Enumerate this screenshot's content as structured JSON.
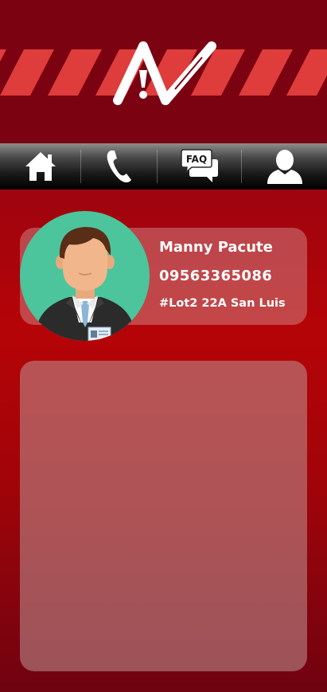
{
  "colors": {
    "header_background": "#7a0211",
    "stripe": "#df3c3c",
    "avatar_background": "#4cc49c"
  },
  "header": {
    "logo_letters": "AV!"
  },
  "nav": {
    "items": [
      {
        "name": "home",
        "icon": "home-icon"
      },
      {
        "name": "call",
        "icon": "phone-icon"
      },
      {
        "name": "faq",
        "icon": "faq-chat-icon",
        "badge_text": "FAQ"
      },
      {
        "name": "profile",
        "icon": "user-icon"
      }
    ]
  },
  "profile": {
    "avatar_icon": "businessman-avatar",
    "name": "Manny Pacute",
    "phone": "09563365086",
    "address": "#Lot2 22A San Luis"
  }
}
